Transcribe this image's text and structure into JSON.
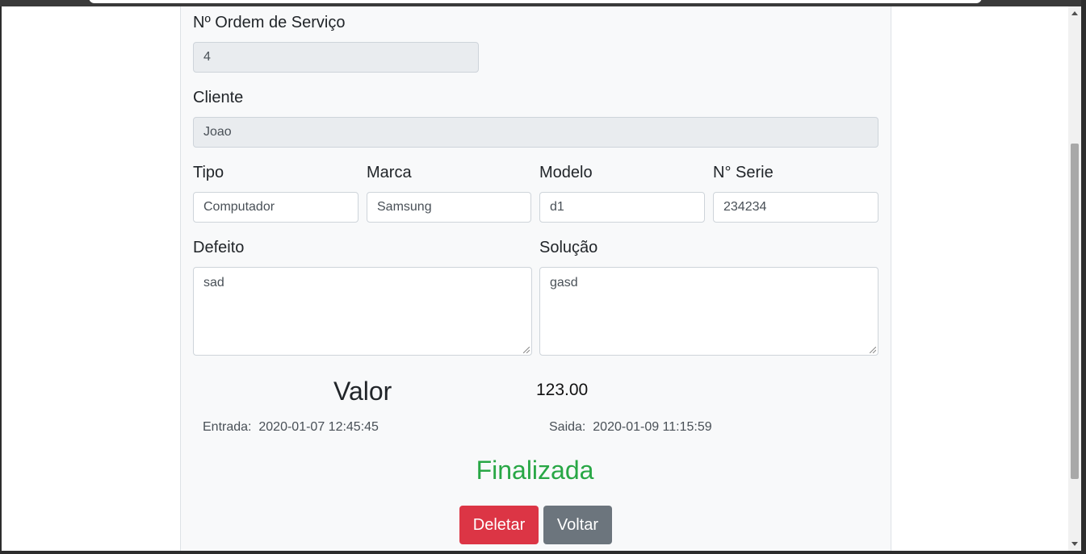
{
  "form": {
    "ordem_label": "Nº Ordem de Serviço",
    "ordem_value": "4",
    "cliente_label": "Cliente",
    "cliente_value": "Joao",
    "tipo_label": "Tipo",
    "tipo_value": "Computador",
    "marca_label": "Marca",
    "marca_value": "Samsung",
    "modelo_label": "Modelo",
    "modelo_value": "d1",
    "serie_label": "N° Serie",
    "serie_value": "234234",
    "defeito_label": "Defeito",
    "defeito_value": "sad",
    "solucao_label": "Solução",
    "solucao_value": "gasd"
  },
  "summary": {
    "valor_label": "Valor",
    "valor_value": "123.00",
    "entrada_label": "Entrada:",
    "entrada_value": "2020-01-07 12:45:45",
    "saida_label": "Saida:",
    "saida_value": "2020-01-09 11:15:59",
    "status": "Finalizada"
  },
  "actions": {
    "delete_label": "Deletar",
    "back_label": "Voltar"
  },
  "colors": {
    "status": "#28a745",
    "danger": "#dc3545",
    "secondary": "#6c757d",
    "panel": "#f8f9fa"
  }
}
